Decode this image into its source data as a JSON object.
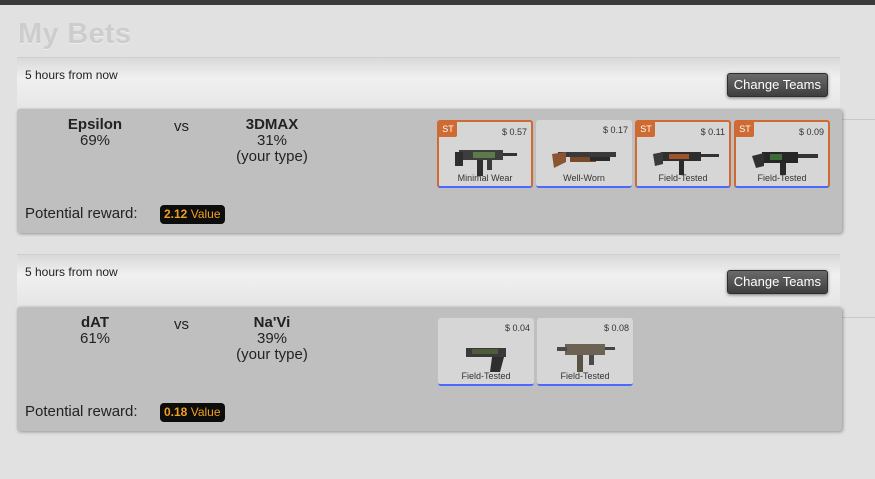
{
  "page": {
    "title": "My Bets"
  },
  "bets": [
    {
      "time": "5 hours from now",
      "change_label": "Change Teams",
      "team1": {
        "name": "Epsilon",
        "pct": "69%"
      },
      "vs": "vs",
      "team2": {
        "name": "3DMAX",
        "pct": "31%",
        "note": "(your type)"
      },
      "reward_label": "Potential reward:",
      "reward_amount": "2.12",
      "reward_unit": "Value",
      "items": [
        {
          "st": "ST",
          "price": "$ 0.57",
          "wear": "Minimal Wear",
          "icon": "ump-gun-icon"
        },
        {
          "st": "",
          "price": "$ 0.17",
          "wear": "Well-Worn",
          "icon": "shotgun-icon"
        },
        {
          "st": "ST",
          "price": "$ 0.11",
          "wear": "Field-Tested",
          "icon": "rifle-icon"
        },
        {
          "st": "ST",
          "price": "$ 0.09",
          "wear": "Field-Tested",
          "icon": "machinegun-icon"
        }
      ]
    },
    {
      "time": "5 hours from now",
      "change_label": "Change Teams",
      "team1": {
        "name": "dAT",
        "pct": "61%"
      },
      "vs": "vs",
      "team2": {
        "name": "Na'Vi",
        "pct": "39%",
        "note": "(your type)"
      },
      "reward_label": "Potential reward:",
      "reward_amount": "0.18",
      "reward_unit": "Value",
      "items": [
        {
          "st": "",
          "price": "$ 0.04",
          "wear": "Field-Tested",
          "icon": "pistol-icon"
        },
        {
          "st": "",
          "price": "$ 0.08",
          "wear": "Field-Tested",
          "icon": "smg-icon"
        }
      ]
    }
  ],
  "colors": {
    "stattrak": "#cf6a32",
    "rarity_blue": "#4b69ff",
    "value_text": "#f0a020"
  }
}
